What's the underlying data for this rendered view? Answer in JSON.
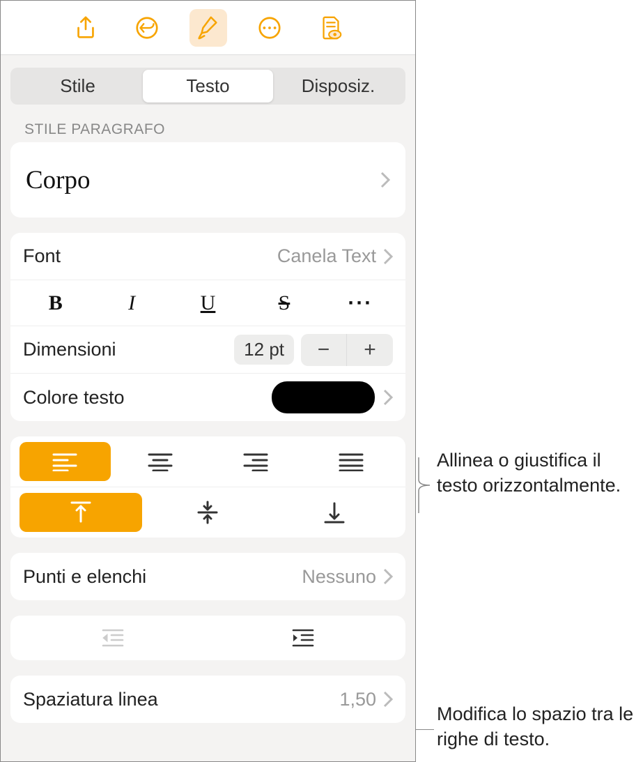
{
  "toolbar": {
    "icons": [
      "share-icon",
      "undo-icon",
      "format-brush-icon",
      "more-circle-icon",
      "doc-eye-icon"
    ]
  },
  "tabs": {
    "stile": "Stile",
    "testo": "Testo",
    "disposiz": "Disposiz."
  },
  "paragraph_style": {
    "section_label": "STILE PARAGRAFO",
    "current": "Corpo"
  },
  "font": {
    "label": "Font",
    "value": "Canela Text",
    "bold_letter": "B",
    "italic_letter": "I",
    "underline_letter": "U",
    "strike_letter": "S",
    "more": "···"
  },
  "size": {
    "label": "Dimensioni",
    "value": "12 pt",
    "minus": "−",
    "plus": "+"
  },
  "text_color": {
    "label": "Colore testo",
    "value": "#000000"
  },
  "alignment": {
    "h_selected": 0,
    "v_selected": 0
  },
  "bullets": {
    "label": "Punti e elenchi",
    "value": "Nessuno"
  },
  "line_spacing": {
    "label": "Spaziatura linea",
    "value": "1,50"
  },
  "callouts": {
    "align": "Allinea o giustifica il testo orizzontalmente.",
    "spacing": "Modifica lo spazio tra le righe di testo."
  }
}
